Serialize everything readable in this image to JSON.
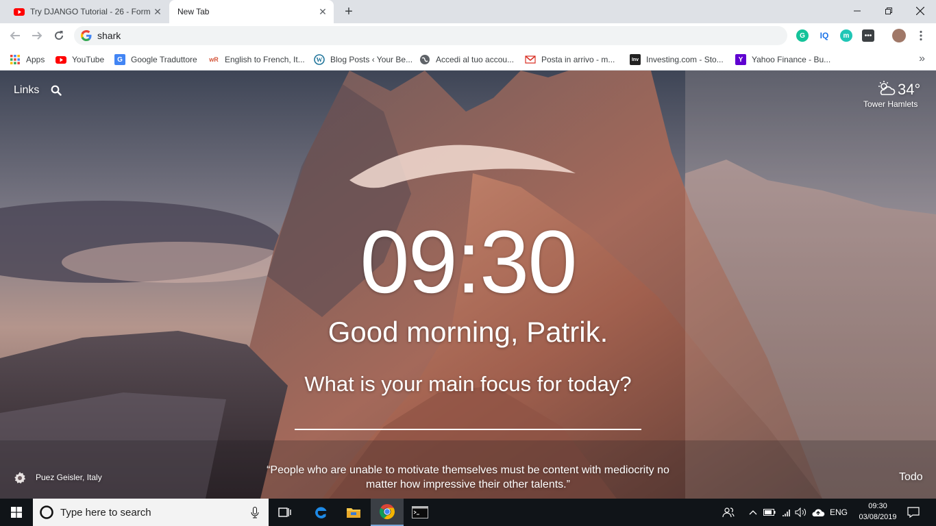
{
  "tabs": [
    {
      "title": "Try DJANGO Tutorial - 26 - Form",
      "active": false
    },
    {
      "title": "New Tab",
      "active": true
    }
  ],
  "omnibox": {
    "value": "shark"
  },
  "bookmarks": {
    "items": [
      {
        "label": "Apps"
      },
      {
        "label": "YouTube"
      },
      {
        "label": "Google Traduttore"
      },
      {
        "label": "English to French, It..."
      },
      {
        "label": "Blog Posts ‹ Your Be..."
      },
      {
        "label": "Accedi al tuo accou..."
      },
      {
        "label": "Posta in arrivo - m..."
      },
      {
        "label": "Investing.com - Sto..."
      },
      {
        "label": "Yahoo Finance - Bu..."
      }
    ],
    "more": "»"
  },
  "dashboard": {
    "links_label": "Links",
    "temperature": "34°",
    "location": "Tower Hamlets",
    "time": "09:30",
    "greeting": "Good morning, Patrik.",
    "focus_prompt": "What is your main focus for today?",
    "photo_location": "Puez Geisler, Italy",
    "quote": "“People who are unable to motivate themselves must be content with mediocrity no matter how impressive their other talents.”",
    "todo_label": "Todo"
  },
  "taskbar": {
    "search_placeholder": "Type here to search",
    "language": "ENG",
    "time": "09:30",
    "date": "03/08/2019"
  }
}
